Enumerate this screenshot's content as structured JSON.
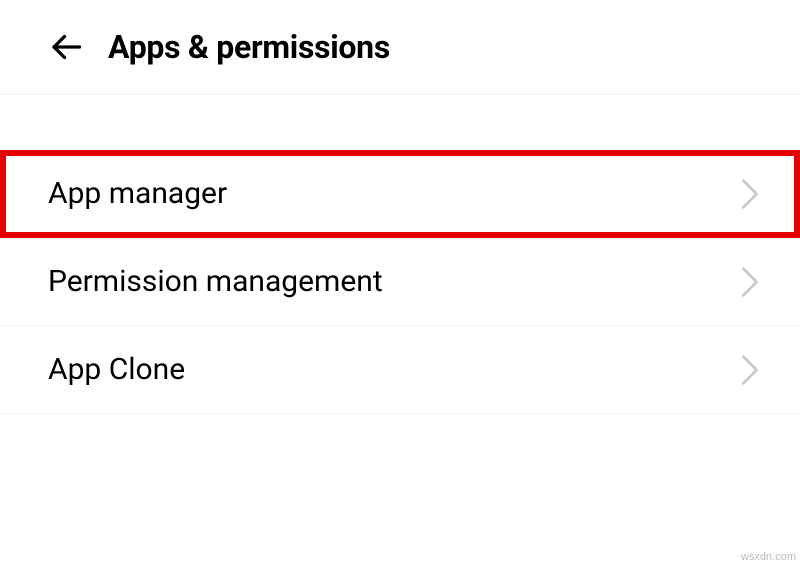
{
  "header": {
    "title": "Apps & permissions"
  },
  "list": {
    "items": [
      {
        "label": "App manager",
        "highlighted": true
      },
      {
        "label": "Permission management",
        "highlighted": false
      },
      {
        "label": "App Clone",
        "highlighted": false
      }
    ]
  },
  "watermark": "wsxdn.com"
}
